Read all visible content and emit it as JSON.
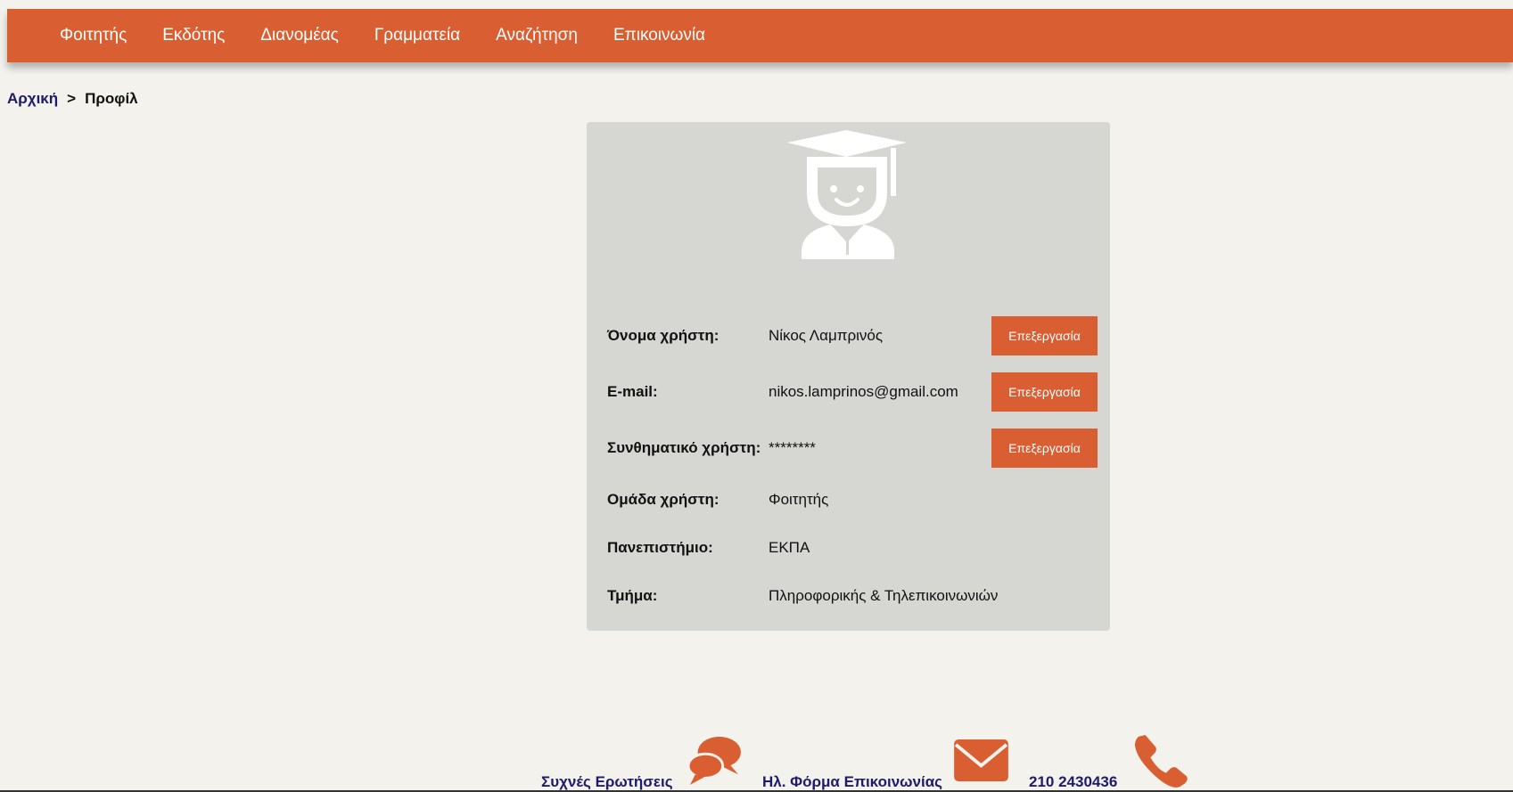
{
  "nav": {
    "items": [
      {
        "label": "Φοιτητής"
      },
      {
        "label": "Εκδότης"
      },
      {
        "label": "Διανομέας"
      },
      {
        "label": "Γραμματεία"
      },
      {
        "label": "Αναζήτηση"
      },
      {
        "label": "Επικοινωνία"
      }
    ]
  },
  "breadcrumb": {
    "home": "Αρχική",
    "separator": ">",
    "current": "Προφίλ"
  },
  "profile": {
    "avatar_icon": "graduate-student-icon",
    "rows": [
      {
        "label": "Όνομα χρήστη:",
        "value": "Νίκος Λαμπρινός",
        "edit": "Επεξεργασία"
      },
      {
        "label": "E-mail:",
        "value": "nikos.lamprinos@gmail.com",
        "edit": "Επεξεργασία"
      },
      {
        "label": "Συνθηματικό χρήστη:",
        "value": "********",
        "edit": "Επεξεργασία"
      },
      {
        "label": "Ομάδα χρήστη:",
        "value": "Φοιτητής"
      },
      {
        "label": "Πανεπιστήμιο:",
        "value": "ΕΚΠΑ"
      },
      {
        "label": "Τμήμα:",
        "value": "Πληροφορικής & Τηλεπικοινωνιών"
      }
    ]
  },
  "footer": {
    "faq_label": "Συχνές Ερωτήσεις",
    "faq_icon": "chat-bubbles-icon",
    "form_label": "Ηλ. Φόρμα Επικοινωνίας",
    "form_icon": "envelope-icon",
    "phone_label": "210 2430436",
    "phone_icon": "phone-icon"
  },
  "colors": {
    "accent": "#d95f33",
    "background": "#f3f2ec",
    "card": "#d6d6d2",
    "link": "#1f1a6b"
  }
}
